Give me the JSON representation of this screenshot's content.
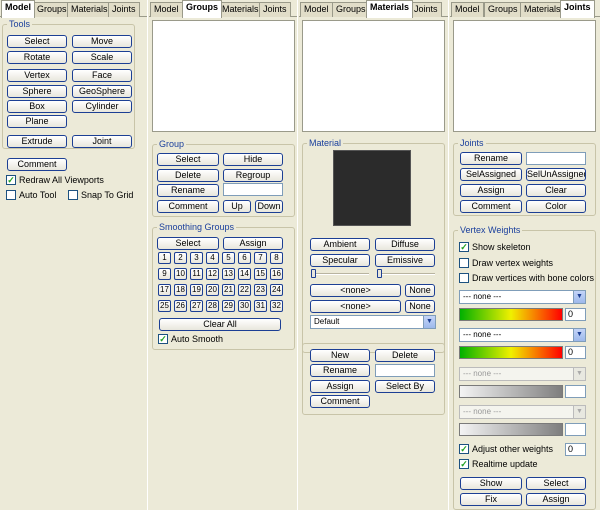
{
  "tabs": [
    "Model",
    "Groups",
    "Materials",
    "Joints"
  ],
  "model": {
    "tools_title": "Tools",
    "buttons": {
      "select": "Select",
      "move": "Move",
      "rotate": "Rotate",
      "scale": "Scale",
      "vertex": "Vertex",
      "face": "Face",
      "sphere": "Sphere",
      "geosphere": "GeoSphere",
      "box": "Box",
      "cylinder": "Cylinder",
      "plane": "Plane",
      "extrude": "Extrude",
      "joint": "Joint",
      "comment": "Comment"
    },
    "redraw_all_viewports": "Redraw All Viewports",
    "auto_tool": "Auto Tool",
    "snap_to_grid": "Snap To Grid"
  },
  "groups": {
    "group_title": "Group",
    "buttons": {
      "select": "Select",
      "hide": "Hide",
      "delete": "Delete",
      "regroup": "Regroup",
      "rename": "Rename",
      "comment": "Comment",
      "up": "Up",
      "down": "Down"
    },
    "smoothing_title": "Smoothing Groups",
    "sg_select": "Select",
    "sg_assign": "Assign",
    "sg_numbers": [
      "1",
      "2",
      "3",
      "4",
      "5",
      "6",
      "7",
      "8",
      "9",
      "10",
      "11",
      "12",
      "13",
      "14",
      "15",
      "16",
      "17",
      "18",
      "19",
      "20",
      "21",
      "22",
      "23",
      "24",
      "25",
      "26",
      "27",
      "28",
      "29",
      "30",
      "31",
      "32"
    ],
    "clear_all": "Clear All",
    "auto_smooth": "Auto Smooth"
  },
  "materials": {
    "material_title": "Material",
    "ambient": "Ambient",
    "diffuse": "Diffuse",
    "specular": "Specular",
    "emissive": "Emissive",
    "none_label": "<none>",
    "none_btn": "None",
    "default_material": "Default",
    "new": "New",
    "delete": "Delete",
    "rename": "Rename",
    "assign": "Assign",
    "select_by": "Select By",
    "comment": "Comment"
  },
  "joints": {
    "joints_title": "Joints",
    "rename": "Rename",
    "sel_assigned": "SelAssigned",
    "sel_unassigned": "SelUnAssigned",
    "assign": "Assign",
    "clear": "Clear",
    "comment": "Comment",
    "color": "Color",
    "vertex_weights_title": "Vertex Weights",
    "show_skeleton": "Show skeleton",
    "draw_vertex_weights": "Draw vertex weights",
    "draw_bone_colors": "Draw vertices with bone colors",
    "none_option": "--- none ---",
    "weight_value": "0",
    "adjust_other_weights": "Adjust other weights",
    "realtime_update": "Realtime update",
    "show": "Show",
    "select": "Select",
    "fix": "Fix",
    "assign2": "Assign"
  }
}
